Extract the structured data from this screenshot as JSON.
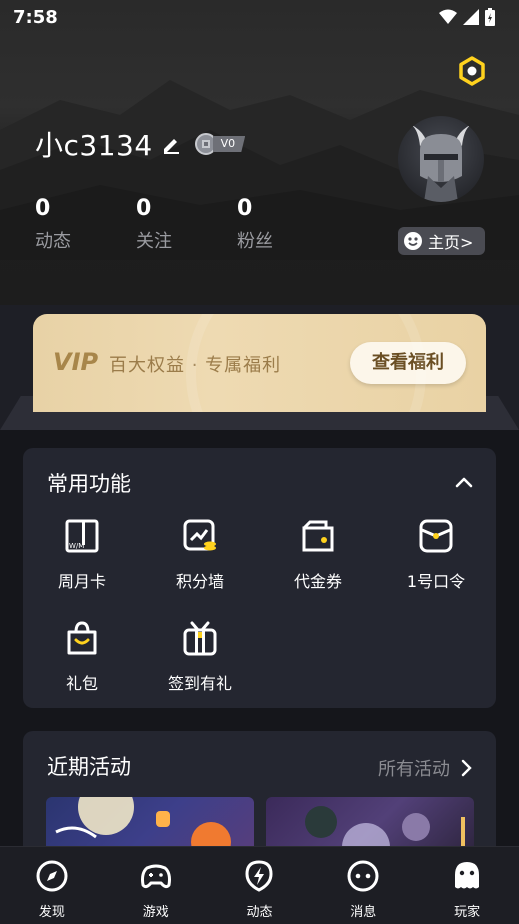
{
  "status_bar": {
    "time": "7:58"
  },
  "profile": {
    "username": "小c3134",
    "level": "V0",
    "stats": [
      {
        "value": "0",
        "label": "动态"
      },
      {
        "value": "0",
        "label": "关注"
      },
      {
        "value": "0",
        "label": "粉丝"
      }
    ],
    "home_button": "主页>"
  },
  "vip": {
    "logo": "VIP",
    "text": "百大权益 · 专属福利",
    "button": "查看福利"
  },
  "common_functions": {
    "title": "常用功能",
    "items": [
      {
        "label": "周月卡",
        "icon": "calendar-card-icon"
      },
      {
        "label": "积分墙",
        "icon": "points-wall-icon"
      },
      {
        "label": "代金券",
        "icon": "voucher-icon"
      },
      {
        "label": "1号口令",
        "icon": "password-icon"
      },
      {
        "label": "礼包",
        "icon": "gift-bag-icon"
      },
      {
        "label": "签到有礼",
        "icon": "checkin-gift-icon"
      }
    ]
  },
  "recent_activities": {
    "title": "近期活动",
    "more": "所有活动"
  },
  "bottom_nav": [
    {
      "label": "发现",
      "icon": "compass-icon"
    },
    {
      "label": "游戏",
      "icon": "gamepad-icon"
    },
    {
      "label": "动态",
      "icon": "lightning-icon"
    },
    {
      "label": "消息",
      "icon": "message-icon"
    },
    {
      "label": "玩家",
      "icon": "player-icon"
    }
  ],
  "colors": {
    "accent": "#ffd21e",
    "vip_gold": "#e9d3a6",
    "card_bg": "#242630"
  }
}
